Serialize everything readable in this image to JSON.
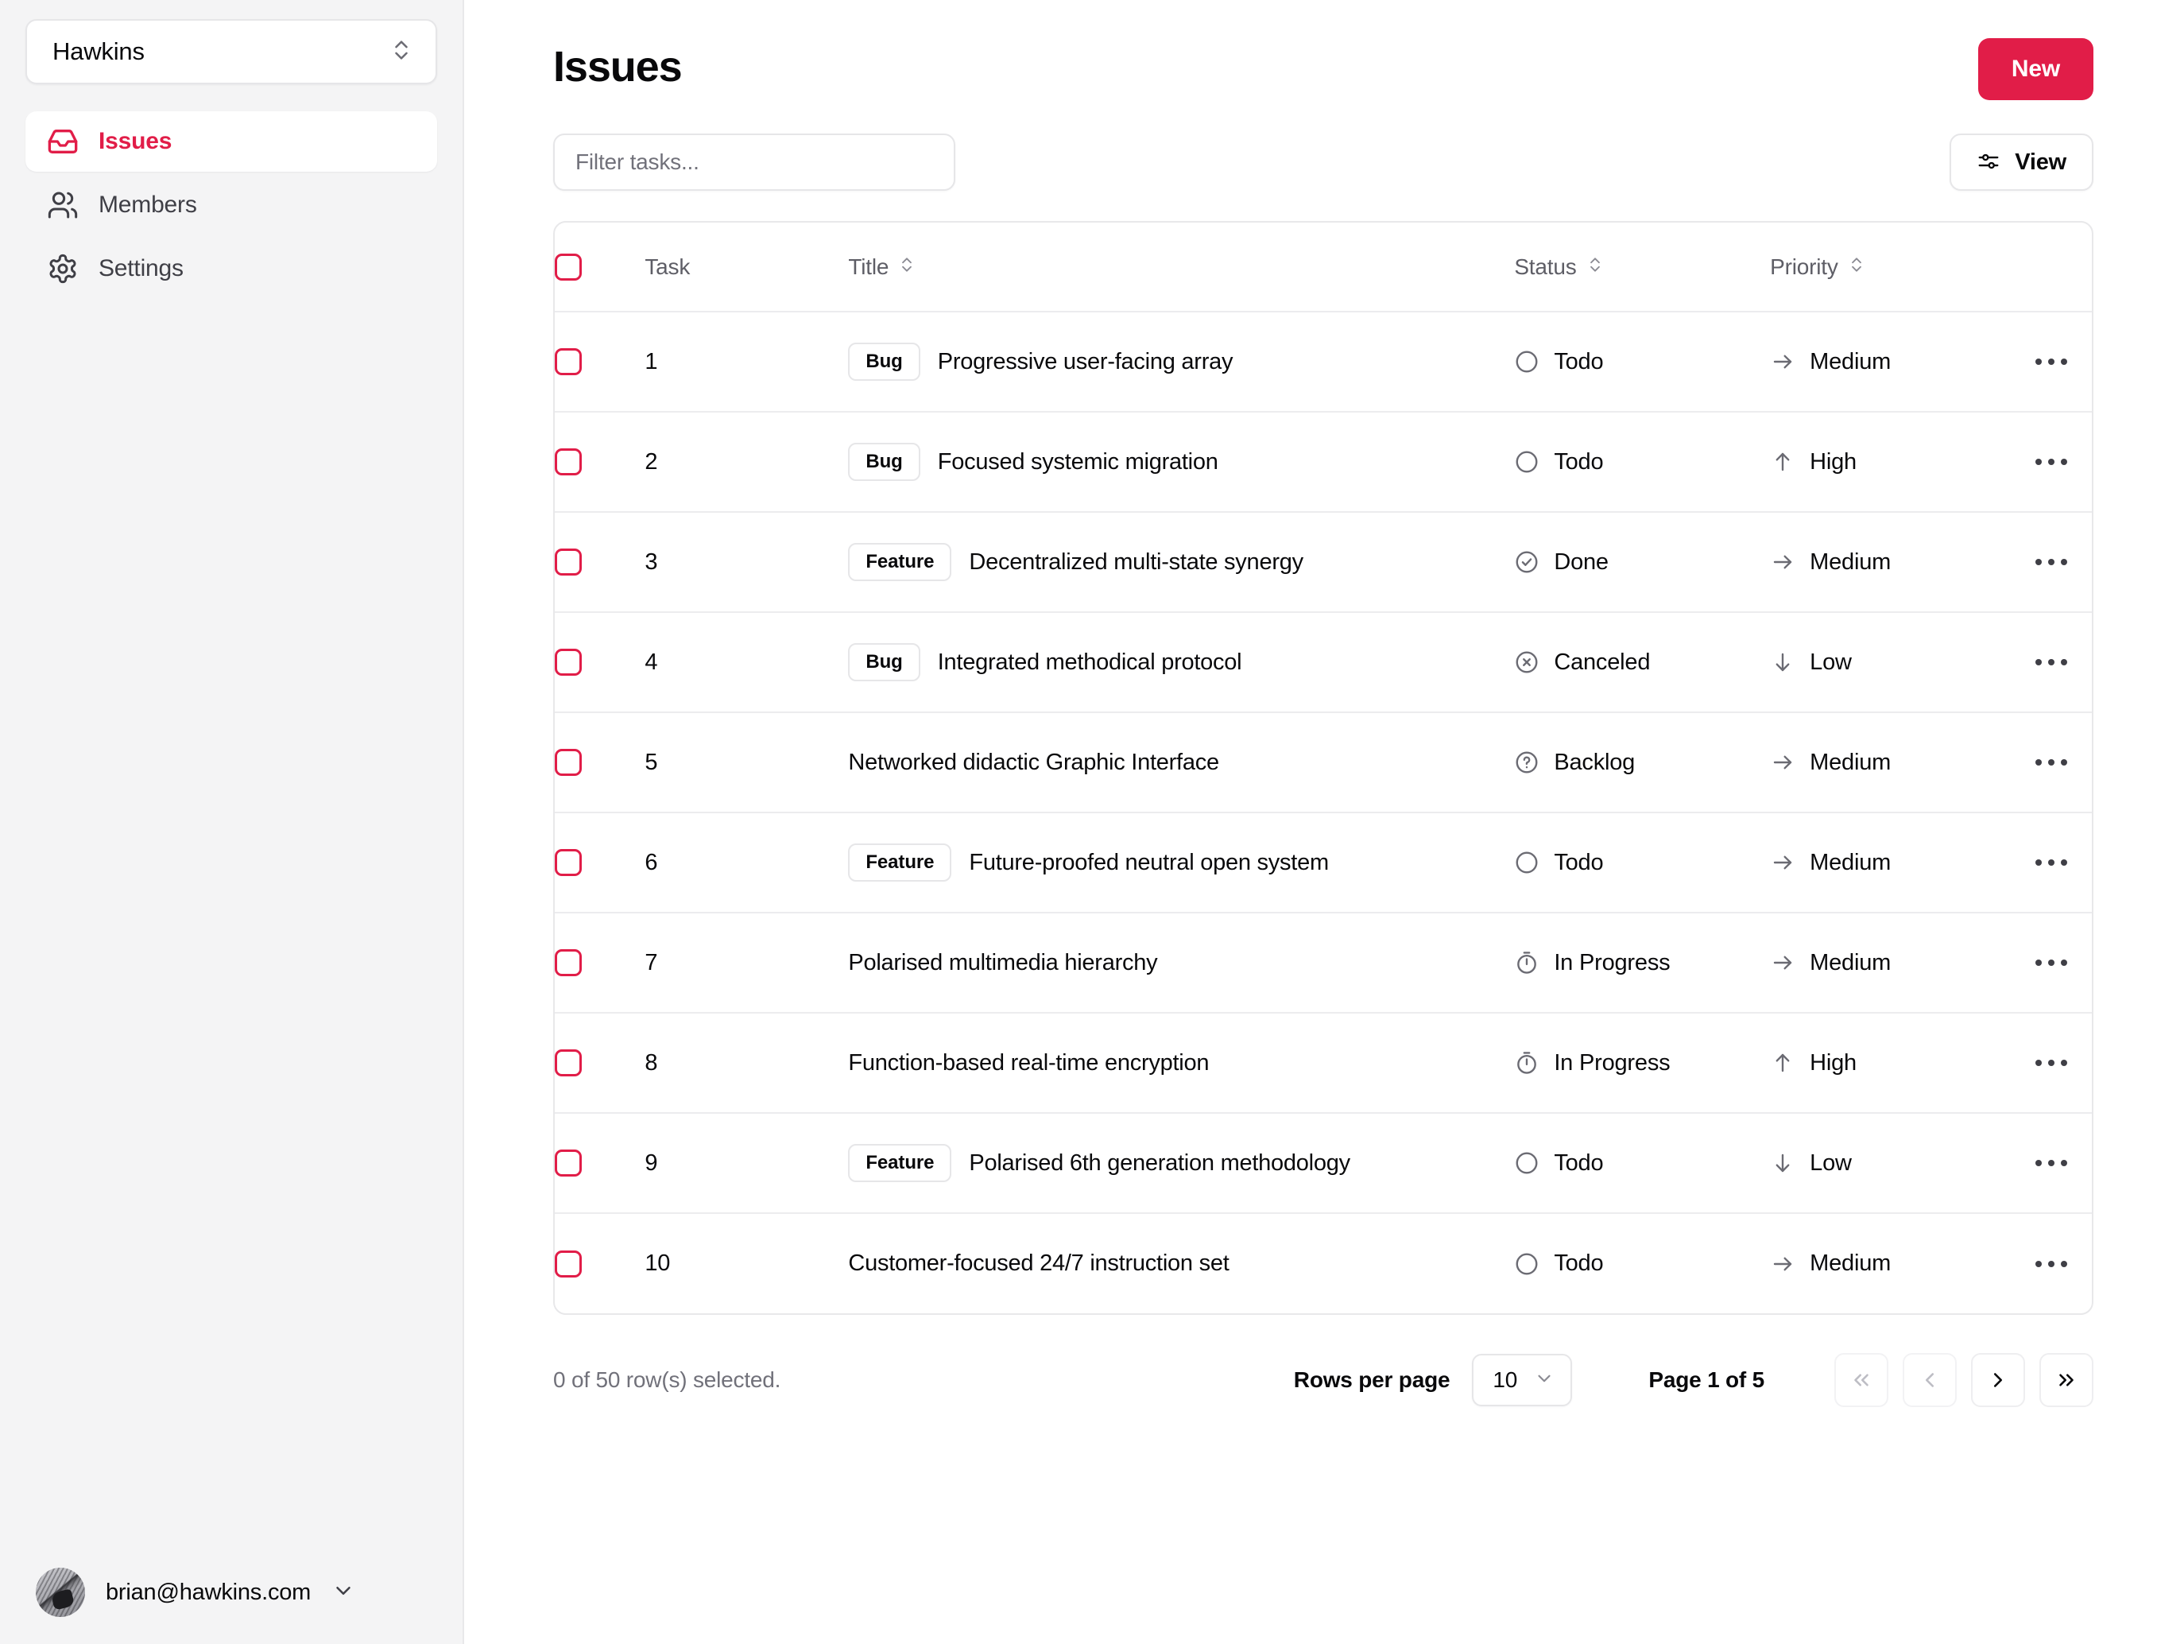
{
  "sidebar": {
    "org": {
      "name": "Hawkins"
    },
    "nav": [
      {
        "label": "Issues",
        "icon": "inbox-icon",
        "active": true
      },
      {
        "label": "Members",
        "icon": "users-icon",
        "active": false
      },
      {
        "label": "Settings",
        "icon": "gear-icon",
        "active": false
      }
    ],
    "user": {
      "email": "brian@hawkins.com"
    }
  },
  "header": {
    "title": "Issues",
    "new_label": "New"
  },
  "toolbar": {
    "filter_placeholder": "Filter tasks...",
    "filter_value": "",
    "view_label": "View"
  },
  "table": {
    "columns": [
      {
        "key": "task",
        "label": "Task",
        "sortable": false
      },
      {
        "key": "title",
        "label": "Title",
        "sortable": true
      },
      {
        "key": "status",
        "label": "Status",
        "sortable": true
      },
      {
        "key": "priority",
        "label": "Priority",
        "sortable": true
      }
    ],
    "rows": [
      {
        "task": "1",
        "badge": "Bug",
        "title": "Progressive user-facing array",
        "status": "Todo",
        "status_icon": "circle-icon",
        "priority": "Medium",
        "priority_icon": "arrow-right-icon"
      },
      {
        "task": "2",
        "badge": "Bug",
        "title": "Focused systemic migration",
        "status": "Todo",
        "status_icon": "circle-icon",
        "priority": "High",
        "priority_icon": "arrow-up-icon"
      },
      {
        "task": "3",
        "badge": "Feature",
        "title": "Decentralized multi-state synergy",
        "status": "Done",
        "status_icon": "check-circle-icon",
        "priority": "Medium",
        "priority_icon": "arrow-right-icon"
      },
      {
        "task": "4",
        "badge": "Bug",
        "title": "Integrated methodical protocol",
        "status": "Canceled",
        "status_icon": "x-circle-icon",
        "priority": "Low",
        "priority_icon": "arrow-down-icon"
      },
      {
        "task": "5",
        "badge": "",
        "title": "Networked didactic Graphic Interface",
        "status": "Backlog",
        "status_icon": "question-circle-icon",
        "priority": "Medium",
        "priority_icon": "arrow-right-icon"
      },
      {
        "task": "6",
        "badge": "Feature",
        "title": "Future-proofed neutral open system",
        "status": "Todo",
        "status_icon": "circle-icon",
        "priority": "Medium",
        "priority_icon": "arrow-right-icon"
      },
      {
        "task": "7",
        "badge": "",
        "title": "Polarised multimedia hierarchy",
        "status": "In Progress",
        "status_icon": "timer-icon",
        "priority": "Medium",
        "priority_icon": "arrow-right-icon"
      },
      {
        "task": "8",
        "badge": "",
        "title": "Function-based real-time encryption",
        "status": "In Progress",
        "status_icon": "timer-icon",
        "priority": "High",
        "priority_icon": "arrow-up-icon"
      },
      {
        "task": "9",
        "badge": "Feature",
        "title": "Polarised 6th generation methodology",
        "status": "Todo",
        "status_icon": "circle-icon",
        "priority": "Low",
        "priority_icon": "arrow-down-icon"
      },
      {
        "task": "10",
        "badge": "",
        "title": "Customer-focused 24/7 instruction set",
        "status": "Todo",
        "status_icon": "circle-icon",
        "priority": "Medium",
        "priority_icon": "arrow-right-icon"
      }
    ]
  },
  "footer": {
    "selection_summary": "0 of 50 row(s) selected.",
    "rows_per_page_label": "Rows per page",
    "rows_per_page_value": "10",
    "page_indicator": "Page 1 of 5",
    "pagination": [
      {
        "icon": "chevrons-left-icon",
        "disabled": true
      },
      {
        "icon": "chevron-left-icon",
        "disabled": true
      },
      {
        "icon": "chevron-right-icon",
        "disabled": false
      },
      {
        "icon": "chevrons-right-icon",
        "disabled": false
      }
    ]
  },
  "colors": {
    "accent": "#e11d48",
    "sidebar_bg": "#f4f4f5",
    "border": "#e8e8ea",
    "muted_text": "#71717a"
  }
}
